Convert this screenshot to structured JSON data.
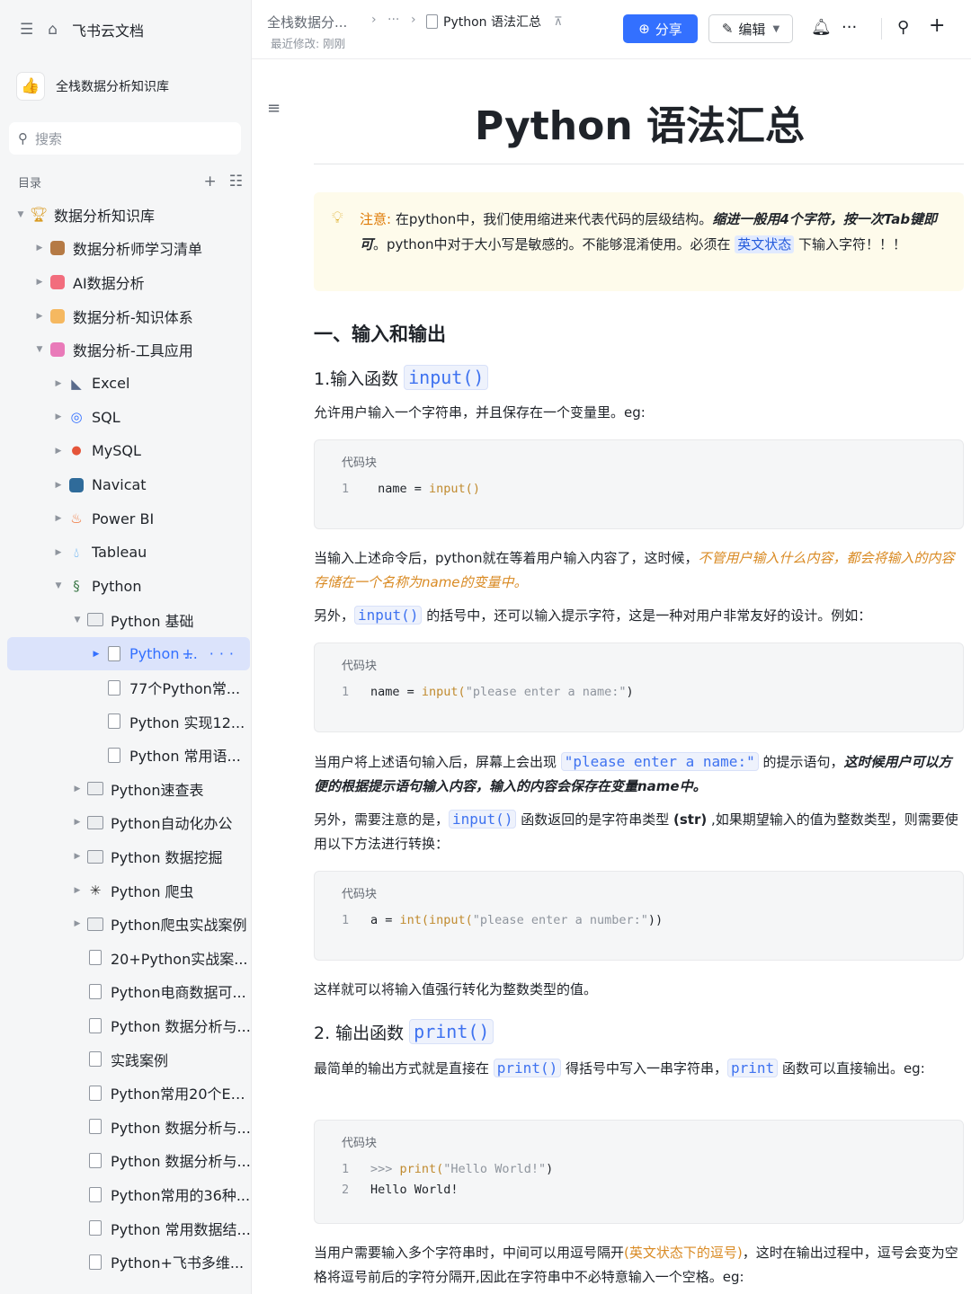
{
  "sidebar": {
    "brand": "飞书云文档",
    "space_name": "全栈数据分析知识库",
    "search_placeholder": "搜索",
    "toc_label": "目录",
    "items": [
      {
        "label": "数据分析知识库",
        "level": 0,
        "icon": "trophy-icon"
      },
      {
        "label": "数据分析师学习清单",
        "level": 1,
        "icon": "book-icon"
      },
      {
        "label": "AI数据分析",
        "level": 1,
        "icon": "ai-icon"
      },
      {
        "label": "数据分析-知识体系",
        "level": 1,
        "icon": "knowledge-icon"
      },
      {
        "label": "数据分析-工具应用",
        "level": 1,
        "icon": "tools-icon"
      },
      {
        "label": "Excel",
        "level": 2,
        "icon": "excel-icon"
      },
      {
        "label": "SQL",
        "level": 2,
        "icon": "sql-icon"
      },
      {
        "label": "MySQL",
        "level": 2,
        "icon": "mysql-icon"
      },
      {
        "label": "Navicat",
        "level": 2,
        "icon": "navicat-icon"
      },
      {
        "label": "Power BI",
        "level": 2,
        "icon": "fire-icon"
      },
      {
        "label": "Tableau",
        "level": 2,
        "icon": "drop-icon"
      },
      {
        "label": "Python",
        "level": 2,
        "icon": "python-icon"
      },
      {
        "label": "Python 基础",
        "level": 3,
        "icon": "folder-icon"
      },
      {
        "label": "Python ...",
        "level": 4,
        "icon": "doc-icon"
      },
      {
        "label": "77个Python常...",
        "level": 4,
        "icon": "doc-icon"
      },
      {
        "label": "Python 实现12...",
        "level": 4,
        "icon": "doc-icon"
      },
      {
        "label": "Python 常用语...",
        "level": 4,
        "icon": "doc-icon"
      },
      {
        "label": "Python速查表",
        "level": 3,
        "icon": "folder-icon"
      },
      {
        "label": "Python自动化办公",
        "level": 3,
        "icon": "folder-icon"
      },
      {
        "label": "Python 数据挖掘",
        "level": 3,
        "icon": "folder-icon"
      },
      {
        "label": "Python 爬虫",
        "level": 3,
        "icon": "spider-icon"
      },
      {
        "label": "Python爬虫实战案例",
        "level": 3,
        "icon": "folder-icon"
      },
      {
        "label": "20+Python实战案...",
        "level": 3,
        "icon": "doc-icon"
      },
      {
        "label": "Python电商数据可...",
        "level": 3,
        "icon": "doc-icon"
      },
      {
        "label": "Python 数据分析与...",
        "level": 3,
        "icon": "doc-icon"
      },
      {
        "label": "实践案例",
        "level": 3,
        "icon": "doc-icon"
      },
      {
        "label": "Python常用20个Ex...",
        "level": 3,
        "icon": "doc-icon"
      },
      {
        "label": "Python 数据分析与...",
        "level": 3,
        "icon": "doc-icon"
      },
      {
        "label": "Python 数据分析与...",
        "level": 3,
        "icon": "doc-icon"
      },
      {
        "label": "Python常用的36种...",
        "level": 3,
        "icon": "doc-icon"
      },
      {
        "label": "Python 常用数据结...",
        "level": 3,
        "icon": "doc-icon"
      },
      {
        "label": "Python+飞书多维...",
        "level": 3,
        "icon": "doc-icon"
      }
    ]
  },
  "header": {
    "crumb1": "全栈数据分...",
    "crumb_more": "···",
    "crumb_doc": "Python 语法汇总",
    "modified": "最近修改: 刚刚",
    "share_label": "分享",
    "edit_label": "编辑"
  },
  "doc": {
    "title": "Python 语法汇总",
    "callout": {
      "prefix": "注意:",
      "t1": " 在python中，我们使用缩进来代表代码的层级结构。",
      "bold1": "缩进一般用4个字符，按一次Tab键即可",
      "t2": "。python中对于大小写是敏感的。不能够混淆使用。必须在 ",
      "hl": "英文状态",
      "t3": " 下输入字符！！！"
    },
    "h1_io": "一、输入和输出",
    "h2_input": "1.输入函数",
    "h2_input_code": "input()",
    "p1": "允许用户输入一个字符串，并且保存在一个变量里。eg:",
    "code_label": "代码块",
    "code1": {
      "ln": "1",
      "a": "name = ",
      "b": "input()"
    },
    "p2_a": "当输入上述命令后，python就在等着用户输入内容了，这时候，",
    "p2_b": "不管用户输入什么内容，都会将输入的内容存储在一个名称为name的变量中。",
    "p3_a": "另外，",
    "p3_code": "input()",
    "p3_b": " 的括号中，还可以输入提示字符，这是一种对用户非常友好的设计。例如：",
    "code2": {
      "ln": "1",
      "a": "name = ",
      "b": "input(",
      "c": "\"please enter a name:\"",
      "d": ")"
    },
    "p4_a": "当用户将上述语句输入后，屏幕上会出现 ",
    "p4_code": "\"please enter a name:\"",
    "p4_b": " 的提示语句，",
    "p4_bold": "这时候用户可以方便的根据提示语句输入内容，输入的内容会保存在变量name中。",
    "p5_a": "另外，需要注意的是，",
    "p5_code": "input()",
    "p5_b": " 函数返回的是字符串类型 ",
    "p5_bold": "(str)",
    "p5_c": " ,如果期望输入的值为整数类型，则需要使用以下方法进行转换：",
    "code3": {
      "ln": "1",
      "a": "a = ",
      "b": "int(input(",
      "c": "\"please enter a number:\"",
      "d": "))"
    },
    "p6": "这样就可以将输入值强行转化为整数类型的值。",
    "h2_print": "2. 输出函数",
    "h2_print_code": "print()",
    "p7_a": "最简单的输出方式就是直接在 ",
    "p7_code": "print()",
    "p7_b": " 得括号中写入一串字符串，",
    "p7_code2": "print",
    "p7_c": " 函数可以直接输出。eg:",
    "code4": {
      "ln1": "1",
      "prompt": ">>> ",
      "a": "print(",
      "b": "\"Hello World!\"",
      "c": ")",
      "ln2": "2",
      "out": "Hello World!"
    },
    "p8_a": "当用户需要输入多个字符串时，中间可以用逗号隔开",
    "p8_hl": "(英文状态下的逗号)",
    "p8_b": "，这时在输出过程中，逗号会变为空格将逗号前后的字符分隔开,因此在字符串中不必特意输入一个空格。eg:"
  },
  "colors": {
    "accent": "#3370ff",
    "warn": "#de7802",
    "italic_orange": "#d98a23"
  }
}
